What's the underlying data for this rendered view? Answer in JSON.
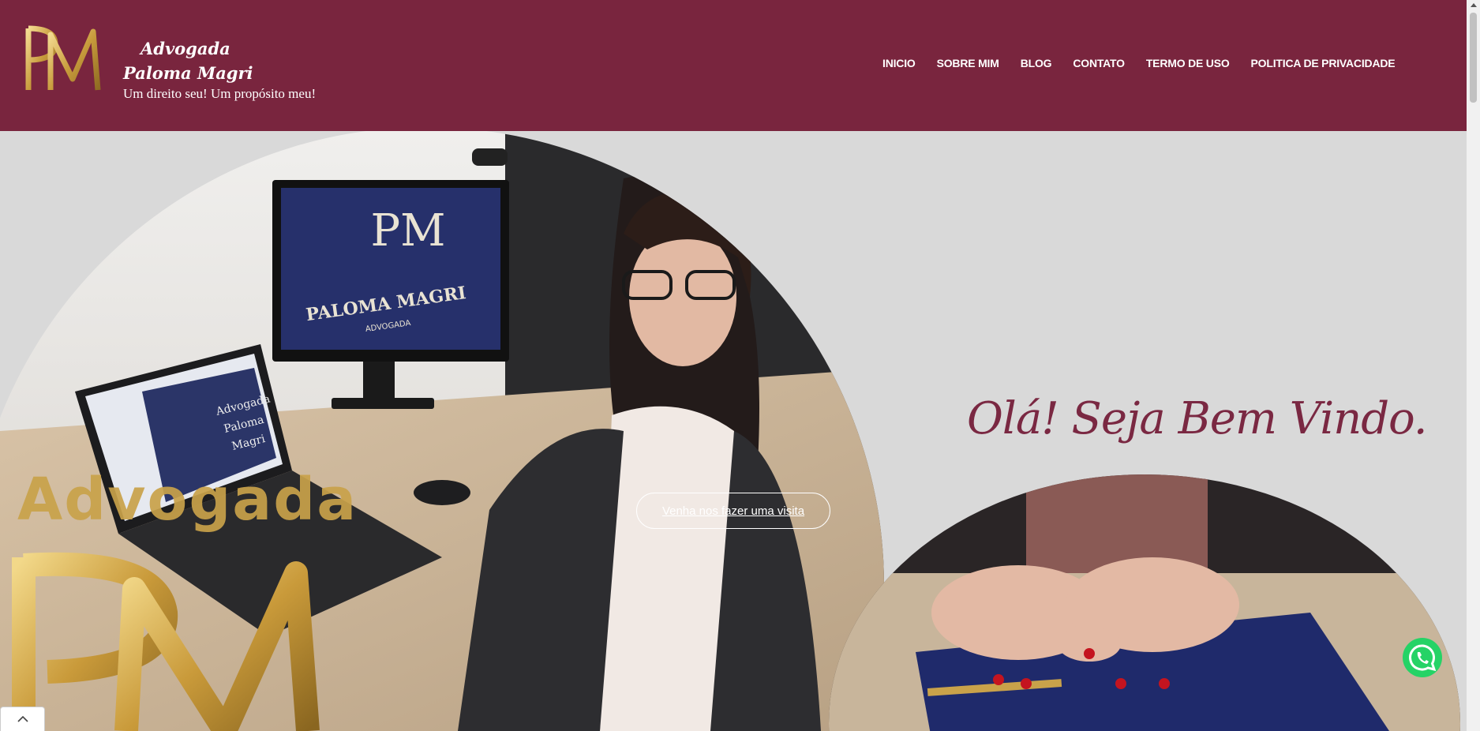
{
  "brand": {
    "line1": "Advogada",
    "line2": "Paloma Magri",
    "tagline": "Um direito seu! Um propósito meu!",
    "logo_letters": "PM"
  },
  "nav": {
    "items": [
      "INICIO",
      "SOBRE MIM",
      "BLOG",
      "CONTATO",
      "TERMO DE USO",
      "POLITICA DE PRIVACIDADE"
    ]
  },
  "hero": {
    "welcome": "Olá! Seja Bem Vindo.",
    "cta": "Venha nos fazer uma visita",
    "overlay_word": "Advogada",
    "monitor_name": "PALOMA MAGRI",
    "monitor_sub": "ADVOGADA",
    "laptop_text_1": "Advogada",
    "laptop_text_2": "Paloma",
    "laptop_text_3": "Magri"
  },
  "colors": {
    "header_bg": "#79253e",
    "accent": "#7a2842",
    "gold": "#c9a24a",
    "whatsapp": "#25d366"
  },
  "icons": {
    "back_to_top": "chevron-up-icon",
    "whatsapp": "whatsapp-icon"
  }
}
